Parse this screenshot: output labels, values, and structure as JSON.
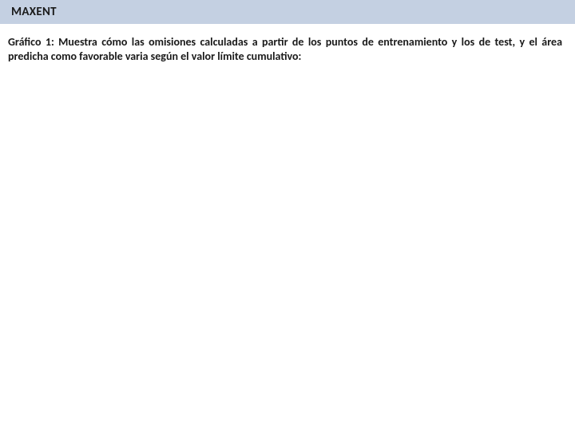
{
  "header": {
    "title": "MAXENT"
  },
  "body": {
    "paragraph": "Gráfico 1: Muestra cómo las omisiones calculadas a partir de los puntos de entrenamiento y los de test, y el área predicha como favorable varia según el valor límite cumulativo:"
  }
}
